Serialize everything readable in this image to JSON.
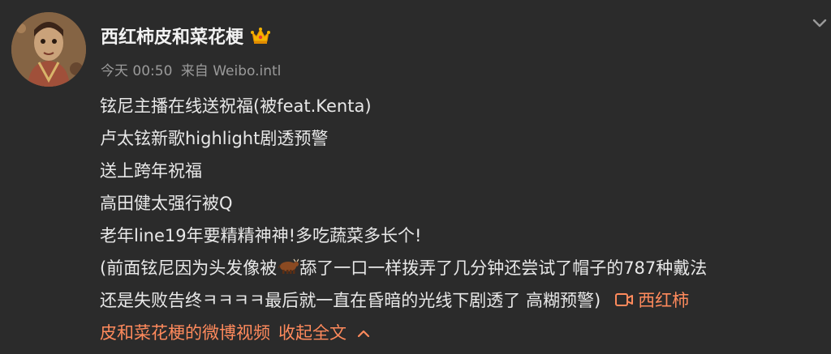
{
  "post": {
    "username": "西红柿皮和菜花梗",
    "time": "今天 00:50",
    "source": "来自 Weibo.intl",
    "lines": [
      "铉尼主播在线送祝福(被feat.Kenta)",
      "卢太铉新歌highlight剧透预警",
      "送上跨年祝福",
      "高田健太强行被Q",
      "老年line19年要精精神神!多吃蔬菜多长个!"
    ],
    "para_part1": "(前面铉尼因为头发像被",
    "para_part2": "舔了一口一样拨弄了几分钟还尝试了帽子的787种戴法",
    "para_line2": "还是失败告终ㅋㅋㅋㅋ最后就一直在昏暗的光线下剧透了 高糊预警)",
    "video_link_part1": "西红柿",
    "video_link_part2": "皮和菜花梗的微博视频",
    "collapse_label": "收起全文",
    "accent_color": "#ff8a5c",
    "badge_icon": "crown-icon"
  }
}
